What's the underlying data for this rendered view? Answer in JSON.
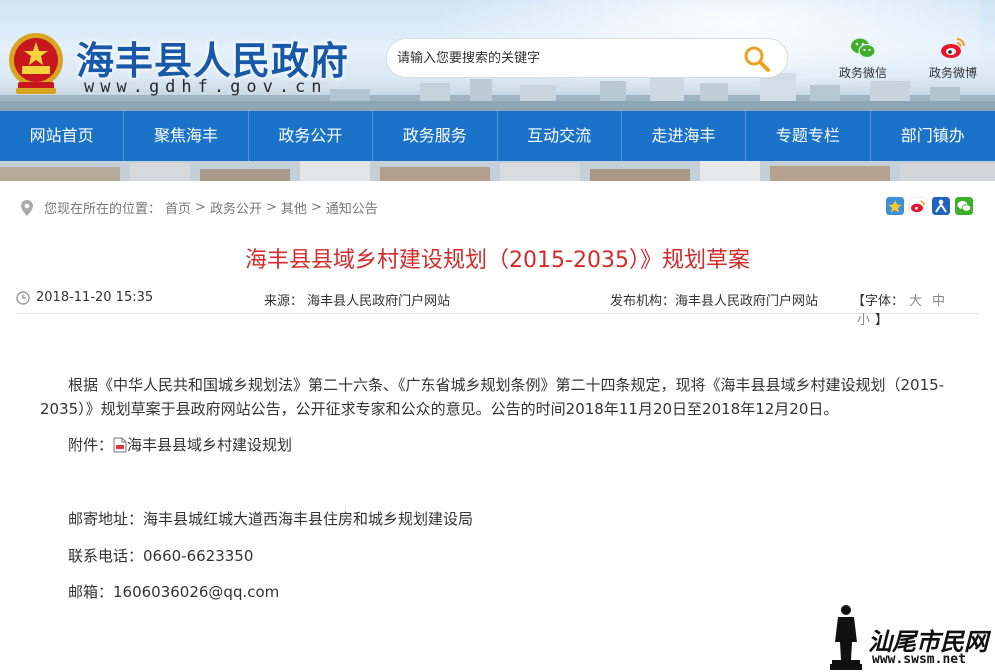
{
  "header": {
    "site_title": "海丰县人民政府",
    "site_url": "www.gdhf.gov.cn",
    "search_placeholder": "请输入您要搜索的关键字",
    "wechat_label": "政务微信",
    "weibo_label": "政务微博"
  },
  "nav": {
    "items": [
      "网站首页",
      "聚焦海丰",
      "政务公开",
      "政务服务",
      "互动交流",
      "走进海丰",
      "专题专栏",
      "部门镇办"
    ]
  },
  "breadcrumb": {
    "prefix": "您现在所在的位置：",
    "items": [
      "首页",
      "政务公开",
      "其他",
      "通知公告"
    ],
    "separator": ">"
  },
  "share_icons": [
    "qzone-icon",
    "weibo-share-icon",
    "renren-icon",
    "wechat-share-icon"
  ],
  "article": {
    "title": "海丰县县域乡村建设规划（2015-2035）》规划草案",
    "date": "2018-11-20 15:35",
    "source_label": "来源：",
    "source": "海丰县人民政府门户网站",
    "org_label": "发布机构：",
    "org": "海丰县人民政府门户网站",
    "font_label": "【字体：",
    "font_sizes": [
      "大",
      "中",
      "小"
    ],
    "font_close": "】",
    "paragraph": "根据《中华人民共和国城乡规划法》第二十六条、《广东省城乡规划条例》第二十四条规定，现将《海丰县县域乡村建设规划（2015-2035）》规划草案于县政府网站公告，公开征求专家和公众的意见。公告的时间2018年11月20日至2018年12月20日。",
    "attachment_label": "附件：",
    "attachment_name": "海丰县县域乡村建设规划",
    "address": "邮寄地址：海丰县城红城大道西海丰县住房和城乡规划建设局",
    "phone": "联系电话：0660-6623350",
    "email": "邮箱：1606036026@qq.com"
  },
  "watermark": {
    "text": "汕尾市民网",
    "url": "www.swsm.net"
  },
  "colors": {
    "nav_blue": "#1a73c8",
    "title_red": "#d42a2a",
    "brand_blue": "#1758a8"
  }
}
